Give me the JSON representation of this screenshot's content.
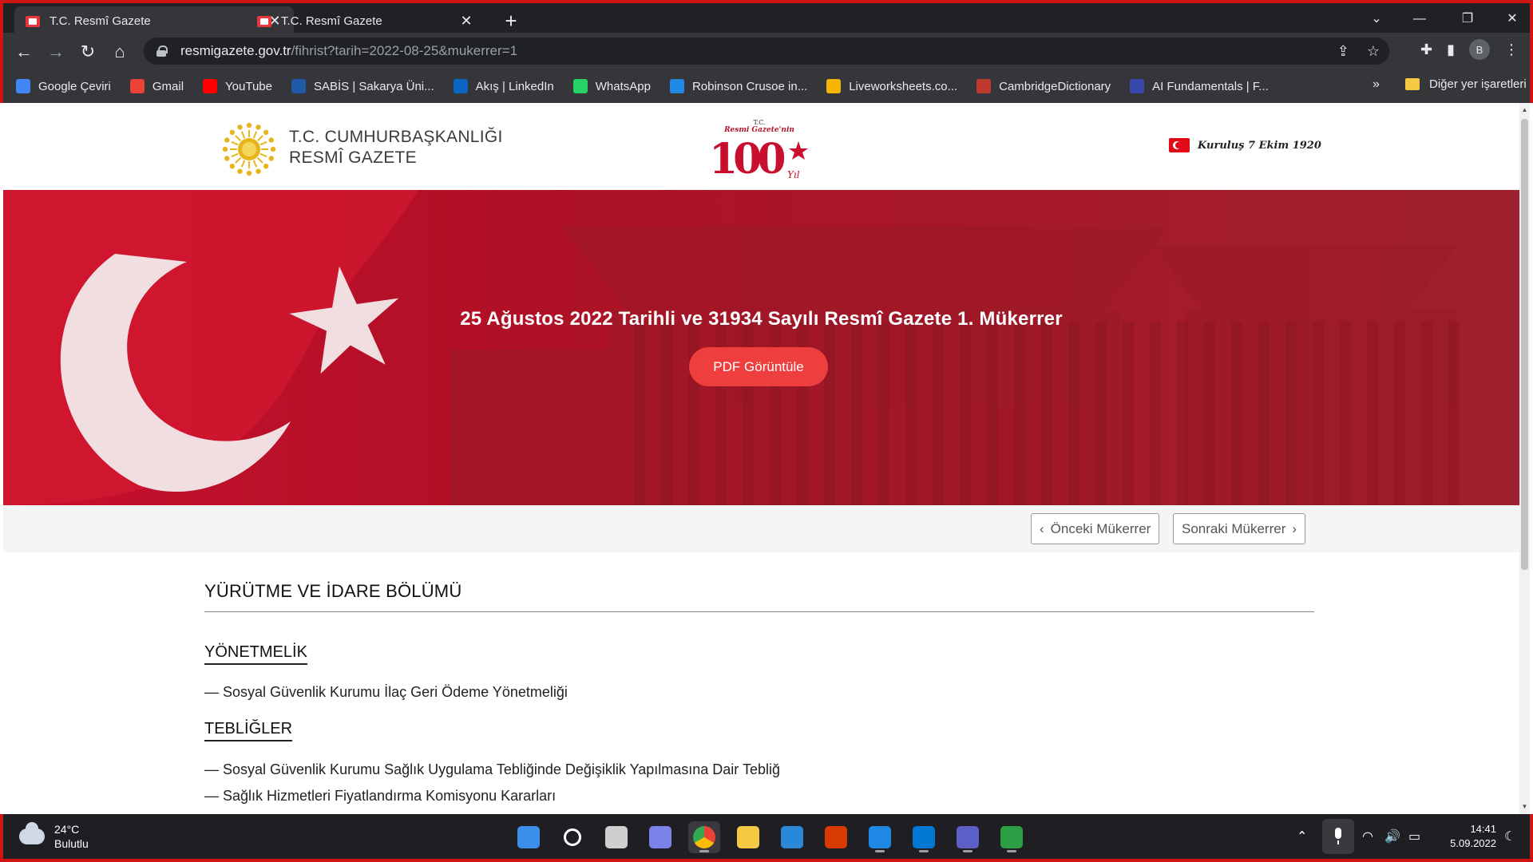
{
  "browser": {
    "tabs": [
      {
        "title": "T.C. Resmî Gazete",
        "active": true
      },
      {
        "title": "T.C. Resmî Gazete",
        "active": false
      }
    ],
    "url_host": "resmigazete.gov.tr",
    "url_path": "/fihrist?tarih=2022-08-25&mukerrer=1",
    "profile_initial": "B",
    "bookmarks": [
      {
        "label": "Google Çeviri",
        "icon": "translate-icon",
        "color": "#4285f4"
      },
      {
        "label": "Gmail",
        "icon": "gmail-icon",
        "color": "#ea4335"
      },
      {
        "label": "YouTube",
        "icon": "youtube-icon",
        "color": "#ff0000"
      },
      {
        "label": "SABİS | Sakarya Üni...",
        "icon": "sabis-icon",
        "color": "#1e5aa8"
      },
      {
        "label": "Akış | LinkedIn",
        "icon": "linkedin-icon",
        "color": "#0a66c2"
      },
      {
        "label": "WhatsApp",
        "icon": "whatsapp-icon",
        "color": "#25d366"
      },
      {
        "label": "Robinson Crusoe in...",
        "icon": "globe-icon",
        "color": "#1e88e5"
      },
      {
        "label": "Liveworksheets.co...",
        "icon": "liveworksheets-icon",
        "color": "#f4b400"
      },
      {
        "label": "CambridgeDictionary",
        "icon": "cambridge-icon",
        "color": "#c0392b"
      },
      {
        "label": "AI Fundamentals | F...",
        "icon": "ai-icon",
        "color": "#3949ab"
      }
    ],
    "bookmarks_more": "»",
    "other_bookmarks": "Diğer yer işaretleri"
  },
  "site": {
    "brand_line1": "T.C. CUMHURBAŞKANLIĞI",
    "brand_line2": "RESMÎ GAZETE",
    "centennial_top": "T.C.",
    "centennial_sub": "Resmi Gazete'nin",
    "centennial_num": "100",
    "centennial_year": "Yıl",
    "founded": "Kuruluş 7 Ekim 1920"
  },
  "hero": {
    "title": "25 Ağustos 2022 Tarihli ve 31934 Sayılı Resmî Gazete 1. Mükerrer",
    "pdf_button": "PDF Görüntüle"
  },
  "pager": {
    "prev": "Önceki Mükerrer",
    "next": "Sonraki Mükerrer"
  },
  "content": {
    "section": "YÜRÜTME VE İDARE BÖLÜMÜ",
    "categories": [
      {
        "title": "YÖNETMELİK",
        "items": [
          "— Sosyal Güvenlik Kurumu İlaç Geri Ödeme Yönetmeliği"
        ]
      },
      {
        "title": "TEBLİĞLER",
        "items": [
          "— Sosyal Güvenlik Kurumu Sağlık Uygulama Tebliğinde Değişiklik Yapılmasına Dair Tebliğ",
          "— Sağlık Hizmetleri Fiyatlandırma Komisyonu Kararları"
        ]
      }
    ]
  },
  "taskbar": {
    "temperature": "24°C",
    "condition": "Bulutlu",
    "time": "14:41",
    "date": "5.09.2022",
    "apps": [
      {
        "name": "start-icon",
        "color": "#3b8eea"
      },
      {
        "name": "search-icon",
        "color": "#ffffff"
      },
      {
        "name": "task-view-icon",
        "color": "#cfcfcf"
      },
      {
        "name": "teams-chat-icon",
        "color": "#7b83eb"
      },
      {
        "name": "chrome-icon",
        "color": "#34a853"
      },
      {
        "name": "file-explorer-icon",
        "color": "#f6c944"
      },
      {
        "name": "mail-icon",
        "color": "#2b88d8"
      },
      {
        "name": "office-icon",
        "color": "#d83b01"
      },
      {
        "name": "sabis-app-icon",
        "color": "#1e88e5"
      },
      {
        "name": "outlook-icon",
        "color": "#0078d4"
      },
      {
        "name": "teams-icon",
        "color": "#5b5fc7"
      },
      {
        "name": "media-player-icon",
        "color": "#2e9e44"
      }
    ]
  },
  "colors": {
    "accent_red": "#e30a17",
    "button_red": "#ef3e3e"
  }
}
